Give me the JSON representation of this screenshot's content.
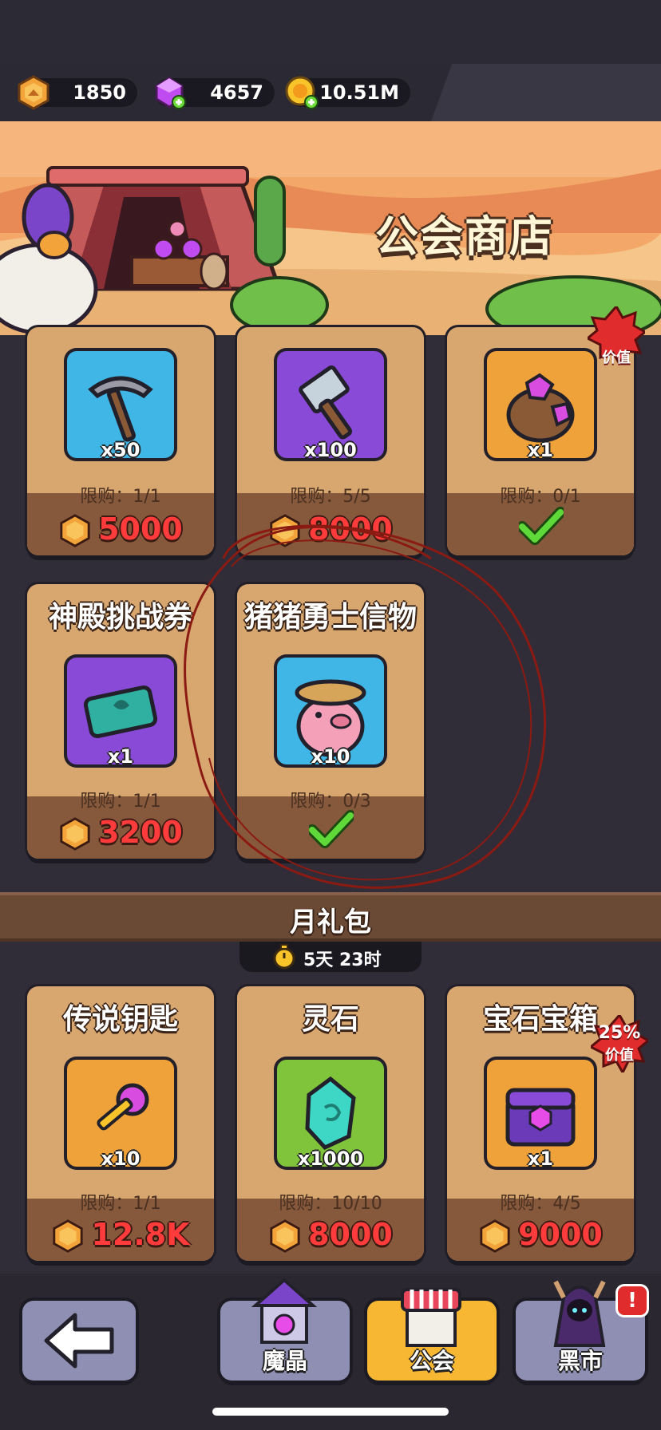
{
  "currencies": [
    {
      "name": "guild-coin",
      "value": "1850"
    },
    {
      "name": "gem",
      "value": "4657"
    },
    {
      "name": "gold",
      "value": "10.51M"
    }
  ],
  "banner": {
    "title": "公会商店"
  },
  "row1": [
    {
      "qty": "x50",
      "limit": "限购：1/1",
      "price": "5000"
    },
    {
      "qty": "x100",
      "limit": "限购：5/5",
      "price": "8000"
    },
    {
      "qty": "x1",
      "limit": "限购：0/1",
      "tag_label": "价值"
    }
  ],
  "row2": [
    {
      "title": "神殿挑战券",
      "qty": "x1",
      "limit": "限购：1/1",
      "price": "3200"
    },
    {
      "title": "猪猪勇士信物",
      "qty": "x10",
      "limit": "限购：0/3"
    }
  ],
  "monthly": {
    "title": "月礼包",
    "timer": "5天 23时",
    "items": [
      {
        "title": "传说钥匙",
        "qty": "x10",
        "limit": "限购：1/1",
        "price": "12.8K"
      },
      {
        "title": "灵石",
        "qty": "x1000",
        "limit": "限购：10/10",
        "price": "8000"
      },
      {
        "title": "宝石宝箱",
        "qty": "x1",
        "limit": "限购：4/5",
        "price": "9000",
        "tag_pct": "25%",
        "tag_label": "价值"
      }
    ]
  },
  "nav": {
    "back": "",
    "crystal": "魔晶",
    "guild": "公会",
    "black_market": "黑市",
    "badge": "!"
  },
  "colors": {
    "price": "#ff3b3b",
    "card": "#d8a66f",
    "accent_active": "#f7b733"
  }
}
